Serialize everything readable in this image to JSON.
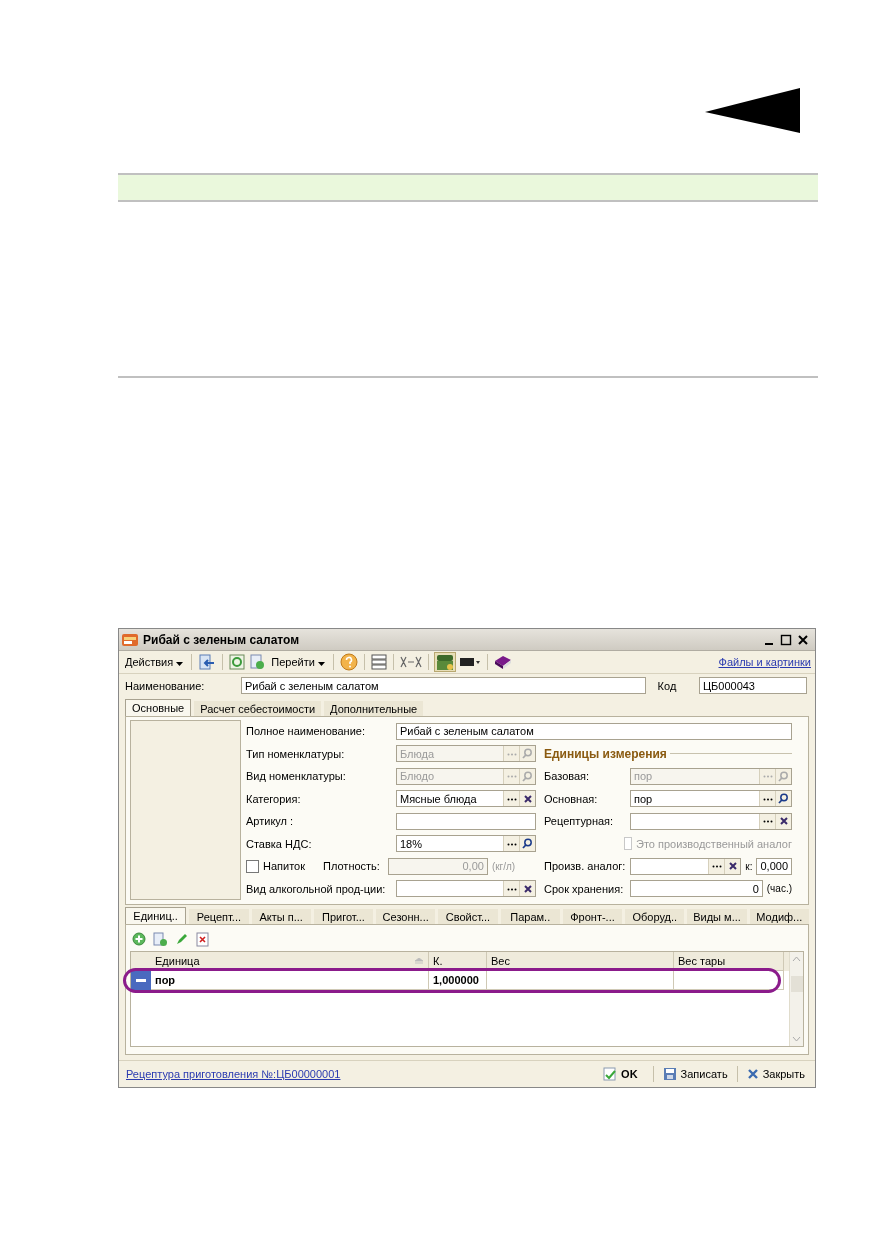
{
  "window": {
    "title": "Рибай с зеленым салатом"
  },
  "toolbar": {
    "actions": "Действия",
    "goto": "Перейти",
    "link": "Файлы и картинки"
  },
  "header": {
    "name_label": "Наименование:",
    "name_value": "Рибай с зеленым салатом",
    "code_label": "Код",
    "code_value": "ЦБ000043"
  },
  "top_tabs": [
    {
      "label": "Основные",
      "selected": true
    },
    {
      "label": "Расчет себестоимости",
      "selected": false
    },
    {
      "label": "Дополнительные",
      "selected": false
    }
  ],
  "full_name": {
    "label": "Полное наименование:",
    "value": "Рибай с зеленым салатом"
  },
  "left_rows": [
    {
      "kind": "lookup",
      "label": "Тип номенклатуры:",
      "value": "Блюда",
      "clearable": false,
      "disabled": true
    },
    {
      "kind": "lookup",
      "label": "Вид номенклатуры:",
      "value": "Блюдо",
      "clearable": false,
      "disabled": true
    },
    {
      "kind": "lookup",
      "label": "Категория:",
      "value": "Мясные блюда",
      "clearable": true,
      "disabled": false
    },
    {
      "kind": "text",
      "label": "Артикул :"
    },
    {
      "kind": "lookup",
      "label": "Ставка НДС:",
      "value": "18%",
      "clearable": false,
      "disabled": false
    },
    {
      "kind": "density",
      "label": "Напиток",
      "checked": false,
      "density_label": "Плотность:",
      "value": "0,00",
      "unit": "(кг/л)"
    },
    {
      "kind": "lookup",
      "label": "Вид алкогольной прод-ции:",
      "clearable": true,
      "disabled": false
    }
  ],
  "units_title": "Единицы измерения",
  "right_rows": [
    {
      "kind": "lookup",
      "label": "Базовая:",
      "value": "пор",
      "clearable": false,
      "disabled": true
    },
    {
      "kind": "lookup",
      "label": "Основная:",
      "value": "пор",
      "clearable": false,
      "disabled": false
    },
    {
      "kind": "lookup",
      "label": "Рецептурная:",
      "clearable": true,
      "disabled": false
    },
    {
      "kind": "checkbox",
      "label": "Это производственный аналог",
      "checked": false,
      "disabled": true
    },
    {
      "kind": "analog",
      "label": "Произв. аналог:",
      "clearable": true,
      "k_label": "к:",
      "k_value": "0,000"
    },
    {
      "kind": "number",
      "label": "Срок хранения:",
      "value": "0",
      "unit": "(час.)"
    }
  ],
  "bottom_tabs": [
    {
      "label": "Единиц..",
      "selected": true
    },
    {
      "label": "Рецепт...",
      "selected": false
    },
    {
      "label": "Акты п...",
      "selected": false
    },
    {
      "label": "Пригот...",
      "selected": false
    },
    {
      "label": "Сезонн...",
      "selected": false
    },
    {
      "label": "Свойст...",
      "selected": false
    },
    {
      "label": "Парам..",
      "selected": false
    },
    {
      "label": "Фронт-...",
      "selected": false
    },
    {
      "label": "Оборуд..",
      "selected": false
    },
    {
      "label": "Виды м...",
      "selected": false
    },
    {
      "label": "Модиф...",
      "selected": false
    }
  ],
  "table": {
    "columns": [
      "Единица",
      "К.",
      "Вес",
      "Вес тары"
    ],
    "rows": [
      {
        "cells": [
          "пор",
          "1,000000",
          "",
          ""
        ]
      }
    ]
  },
  "footer": {
    "link": "Рецептура приготовления №:ЦБ00000001",
    "buttons": [
      "OK",
      "Записать",
      "Закрыть"
    ]
  }
}
